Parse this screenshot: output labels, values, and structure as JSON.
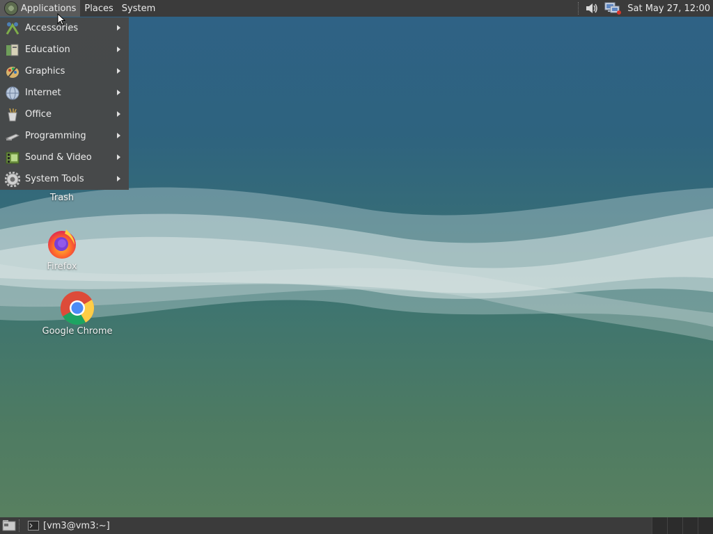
{
  "top_panel": {
    "menus": [
      "Applications",
      "Places",
      "System"
    ],
    "clock": "Sat May 27, 12:00"
  },
  "app_menu": {
    "items": [
      {
        "label": "Accessories",
        "icon": "accessories-icon"
      },
      {
        "label": "Education",
        "icon": "education-icon"
      },
      {
        "label": "Graphics",
        "icon": "graphics-icon"
      },
      {
        "label": "Internet",
        "icon": "internet-icon"
      },
      {
        "label": "Office",
        "icon": "office-icon"
      },
      {
        "label": "Programming",
        "icon": "programming-icon"
      },
      {
        "label": "Sound & Video",
        "icon": "sound-video-icon"
      },
      {
        "label": "System Tools",
        "icon": "system-tools-icon"
      }
    ]
  },
  "desktop": {
    "icons": [
      {
        "label": "Trash"
      },
      {
        "label": "Firefox"
      },
      {
        "label": "Google Chrome"
      }
    ]
  },
  "bottom_panel": {
    "task": "[vm3@vm3:~]"
  },
  "colors": {
    "panel": "#3b3b3b",
    "menu_bg": "#484848",
    "desktop_top": "#2f6286",
    "desktop_bottom": "#5a8160"
  }
}
